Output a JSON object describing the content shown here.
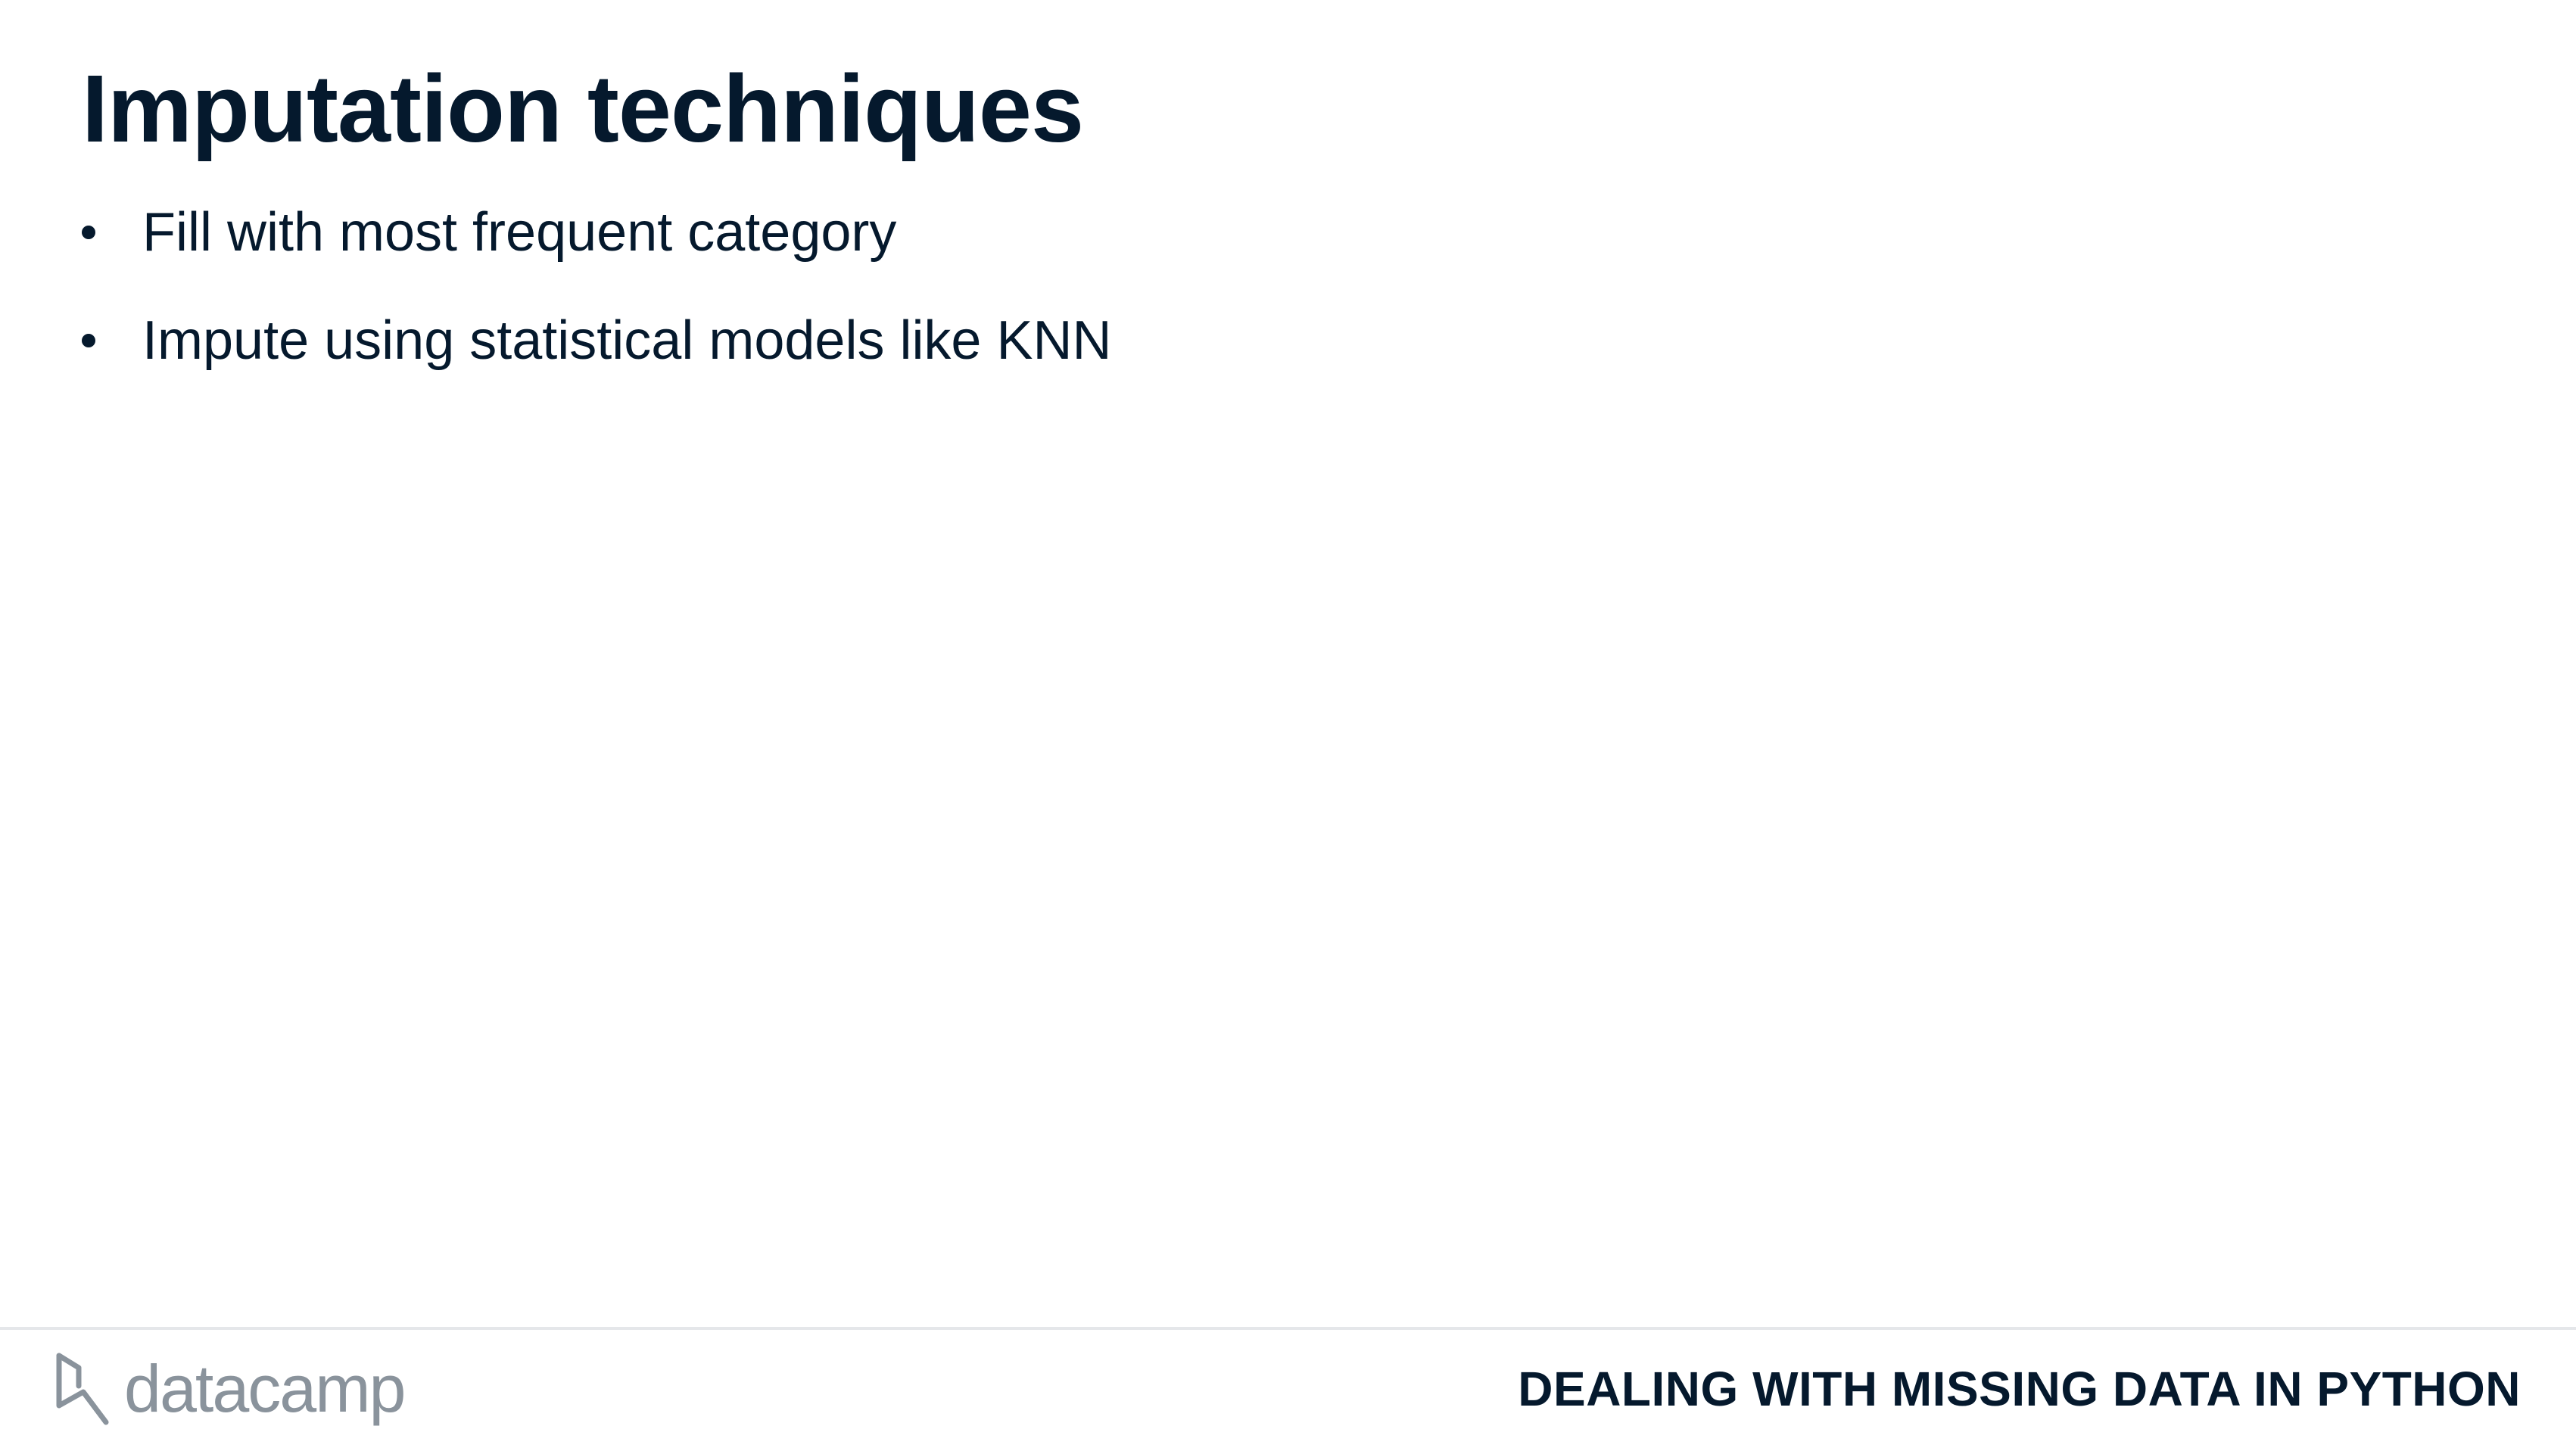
{
  "slide": {
    "title": "Imputation techniques",
    "bullets": [
      "Fill with most frequent category",
      "Impute using statistical models like KNN"
    ]
  },
  "footer": {
    "logo_text": "datacamp",
    "logo_icon": "datacamp-logo-icon",
    "course_title": "DEALING WITH MISSING DATA IN PYTHON"
  },
  "colors": {
    "text": "#05192D",
    "logo_gray": "#8A939C",
    "divider": "#E5E7EA",
    "background": "#FFFFFF"
  }
}
